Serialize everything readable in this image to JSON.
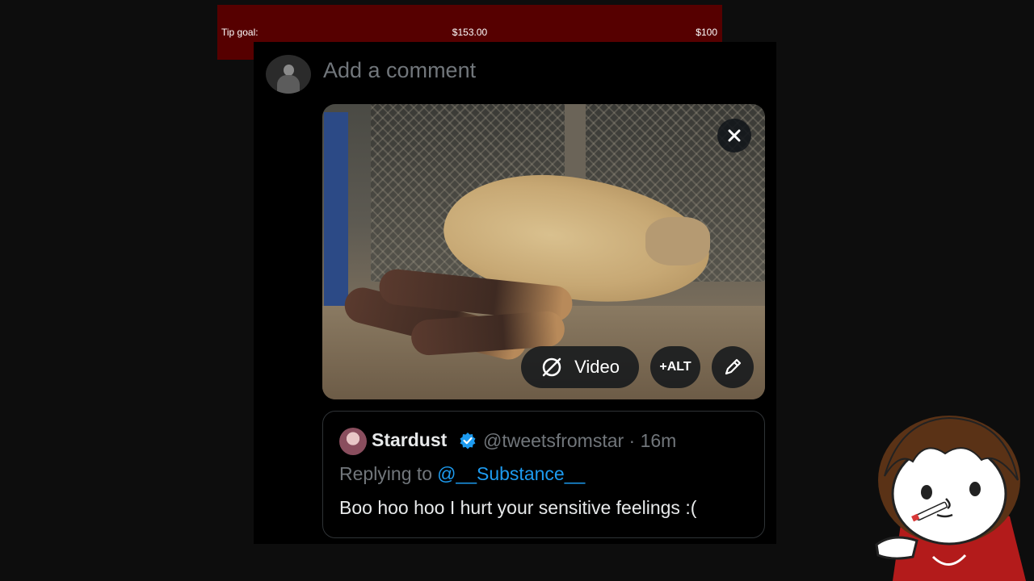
{
  "tip_goal": {
    "label": "Tip goal:",
    "current": "$153.00",
    "target": "$100"
  },
  "composer": {
    "placeholder": "Add a comment"
  },
  "media_controls": {
    "video_label": "Video",
    "alt_label": "+ALT"
  },
  "quoted_tweet": {
    "name": "Stardust",
    "handle_time": "@tweetsfromstar · 16m",
    "replying_prefix": "Replying to",
    "replying_mention": "@__Substance__",
    "text": "Boo hoo hoo I hurt your sensitive feelings :("
  },
  "colors": {
    "tip_bar": "#560000",
    "verified": "#1d9bf0",
    "muted_text": "#71767b",
    "panel": "#000000"
  },
  "icons": [
    "close-icon",
    "gif-video-icon",
    "pencil-icon",
    "verified-badge-icon"
  ]
}
